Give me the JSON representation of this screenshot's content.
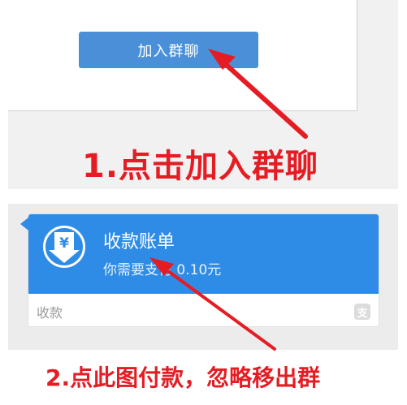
{
  "panel1": {
    "join_button_label": "加入群聊",
    "instruction": "1.点击加入群聊"
  },
  "panel2": {
    "bill_title": "收款账单",
    "bill_subtitle": "你需要支付 0.10元",
    "footer_label": "收款",
    "currency_symbol": "¥",
    "instruction": "2.点此图付款，忽略移出群"
  },
  "colors": {
    "accent_blue": "#4a90d9",
    "card_blue": "#2f8ce6",
    "annotation_red": "#e51c23"
  },
  "icons": {
    "bill_icon": "yen-down-arrow-icon",
    "footer_icon": "alipay-icon"
  }
}
